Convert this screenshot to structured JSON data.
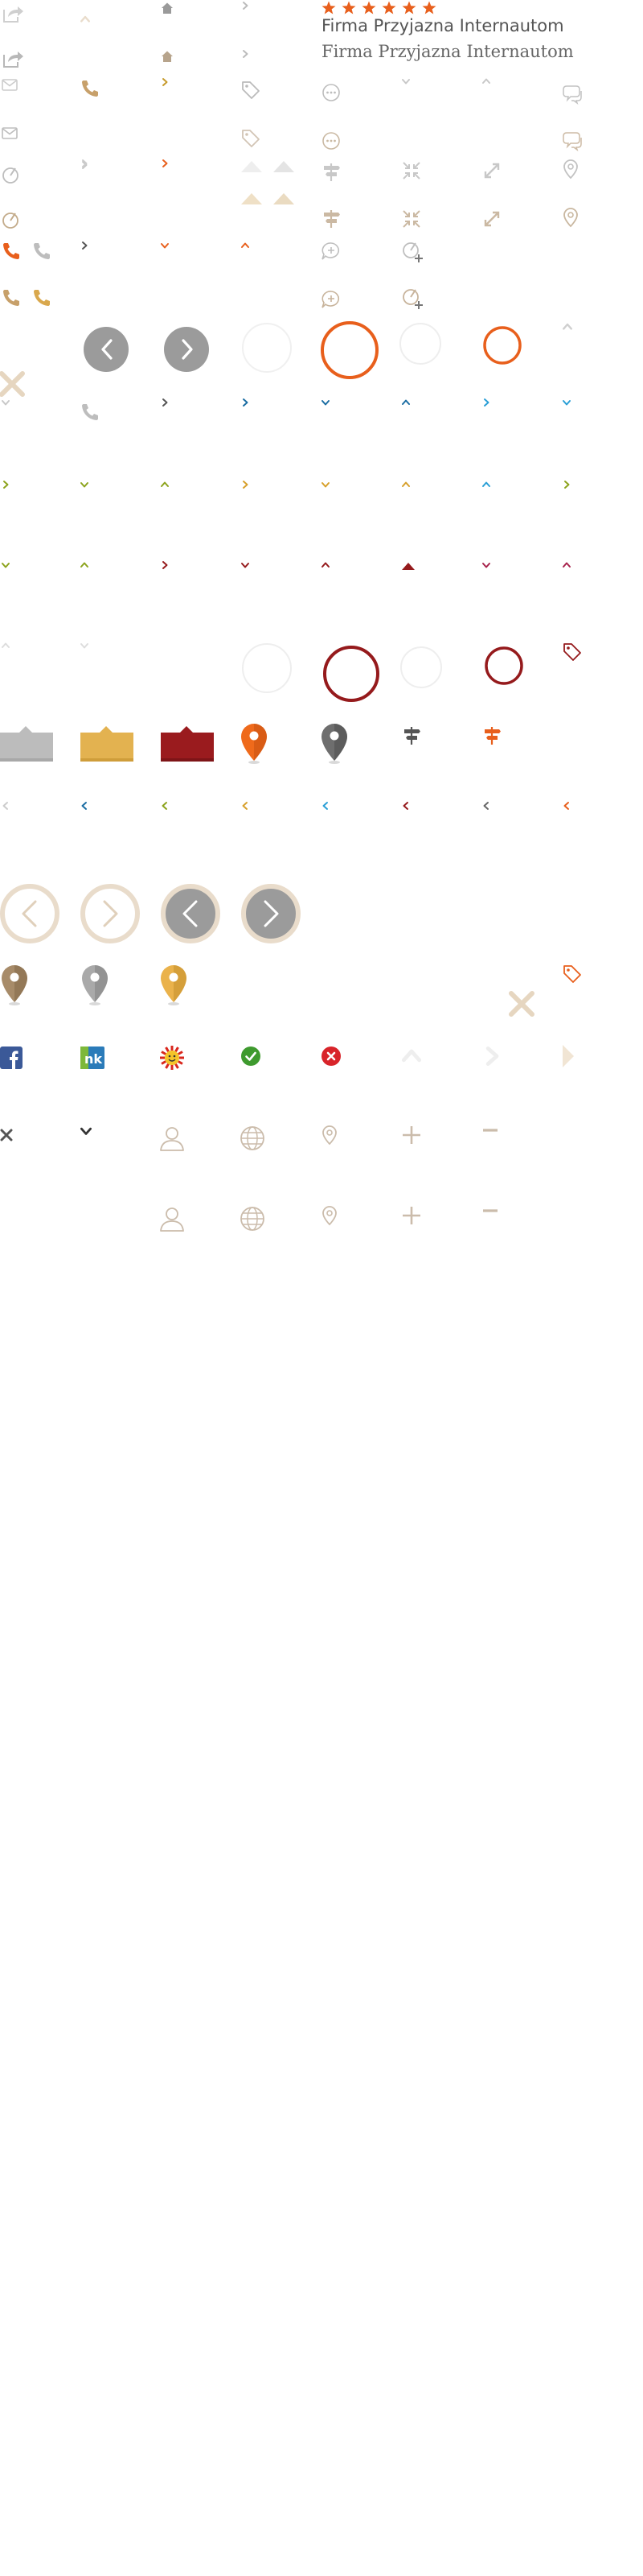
{
  "brand_text_sans": "Firma Przyjazna Internautom",
  "brand_text_serif": "Firma Przyjazna Internautom",
  "rating_stars": 6,
  "colors": {
    "orange": "#e85f1c",
    "beige": "#c4ab8f",
    "light_beige": "#e9dccb",
    "grey": "#b5b5b5",
    "dark_grey": "#6f6f6f",
    "dark_red": "#951a1c",
    "gold": "#e2ad4c",
    "blue": "#1b6da3",
    "green": "#8ca31c",
    "facebook_blue": "#3b5998"
  }
}
